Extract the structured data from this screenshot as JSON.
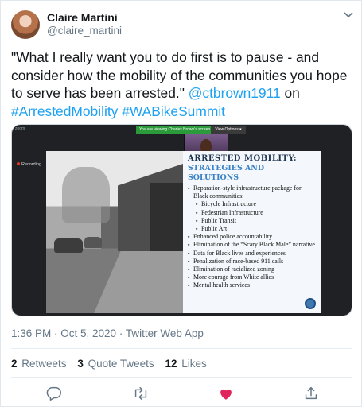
{
  "tweet": {
    "author_name": "Claire Martini",
    "author_handle": "@claire_martini",
    "text_plain_1": "\"What I really want you to do first is to pause - and consider how the mobility of the communities you hope to serve has been arrested.\" ",
    "mention": "@ctbrown1911",
    "text_plain_2": " on ",
    "hashtag_1": "#ArrestedMobility",
    "hashtag_2": "#WABikeSummit",
    "meta": "1:36 PM · Oct 5, 2020 · Twitter Web App",
    "stats": [
      {
        "count": "2",
        "label": "Retweets"
      },
      {
        "count": "3",
        "label": "Quote Tweets"
      },
      {
        "count": "12",
        "label": "Likes"
      }
    ]
  },
  "media": {
    "zoom_banner": "You are viewing Charles Brown's screen",
    "view_options": "View Options ▾",
    "zoom_logo": "zoom",
    "recording": "Recording",
    "slide_title": "ARRESTED MOBILITY:",
    "slide_subtitle": "STRATEGIES AND SOLUTIONS",
    "bullets": [
      {
        "text": "Reparation-style infrastructure package for Black communities:",
        "sub": false
      },
      {
        "text": "Bicycle Infrastructure",
        "sub": true
      },
      {
        "text": "Pedestrian Infrastructure",
        "sub": true
      },
      {
        "text": "Public Transit",
        "sub": true
      },
      {
        "text": "Public Art",
        "sub": true
      },
      {
        "text": "Enhanced police accountability",
        "sub": false
      },
      {
        "text": "Elimination of the “Scary Black Male” narrative",
        "sub": false
      },
      {
        "text": "Data for Black lives and experiences",
        "sub": false
      },
      {
        "text": "Penalization of race-based 911 calls",
        "sub": false
      },
      {
        "text": "Elimination of racialized zoning",
        "sub": false
      },
      {
        "text": "More courage from White allies",
        "sub": false
      },
      {
        "text": "Mental health services",
        "sub": false
      }
    ]
  },
  "icons": {
    "more": "chevron-down-icon",
    "reply": "reply-icon",
    "retweet": "retweet-icon",
    "like": "heart-icon",
    "share": "share-icon"
  },
  "colors": {
    "link": "#1da1f2",
    "like_active": "#e0245e",
    "secondary_text": "#657786"
  }
}
